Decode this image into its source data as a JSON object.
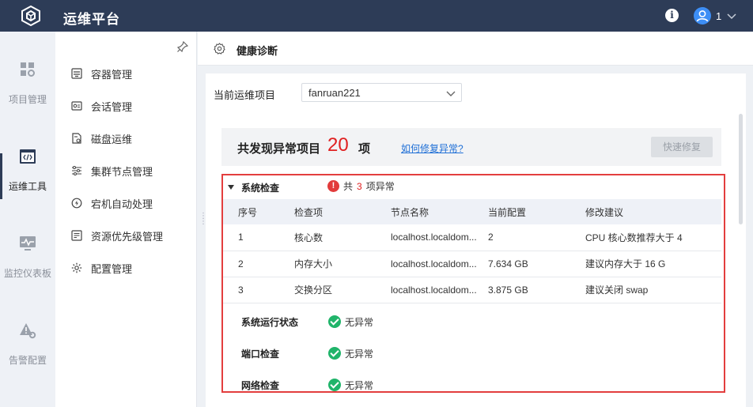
{
  "header": {
    "title": "运维平台",
    "user_name": "1"
  },
  "rail": [
    {
      "label": "项目管理",
      "icon": "grid-gear-icon"
    },
    {
      "label": "运维工具",
      "icon": "code-window-icon"
    },
    {
      "label": "监控仪表板",
      "icon": "monitor-pulse-icon"
    },
    {
      "label": "告警配置",
      "icon": "alert-gear-icon"
    }
  ],
  "submenu": [
    {
      "label": "容器管理",
      "icon": "container-icon"
    },
    {
      "label": "会话管理",
      "icon": "session-icon"
    },
    {
      "label": "磁盘运维",
      "icon": "disk-icon"
    },
    {
      "label": "集群节点管理",
      "icon": "sliders-icon"
    },
    {
      "label": "宕机自动处理",
      "icon": "auto-recover-icon"
    },
    {
      "label": "资源优先级管理",
      "icon": "priority-icon"
    },
    {
      "label": "配置管理",
      "icon": "config-gear-icon"
    }
  ],
  "breadcrumb": {
    "title": "健康诊断"
  },
  "project": {
    "label": "当前运维项目",
    "value": "fanruan221"
  },
  "summary": {
    "prefix": "共发现异常项目",
    "count": "20",
    "suffix": "项",
    "link": "如何修复异常?",
    "quick_fix": "快速修复"
  },
  "system_check": {
    "title": "系统检查",
    "status_prefix": "共",
    "status_count": "3",
    "status_suffix": "项异常",
    "columns": [
      "序号",
      "检查项",
      "节点名称",
      "当前配置",
      "修改建议"
    ],
    "rows": [
      [
        "1",
        "核心数",
        "localhost.localdom...",
        "2",
        "CPU 核心数推荐大于 4"
      ],
      [
        "2",
        "内存大小",
        "localhost.localdom...",
        "7.634 GB",
        "建议内存大于 16 G"
      ],
      [
        "3",
        "交换分区",
        "localhost.localdom...",
        "3.875 GB",
        "建议关闭 swap"
      ]
    ]
  },
  "other_checks": [
    {
      "title": "系统运行状态",
      "status": "无异常"
    },
    {
      "title": "端口检查",
      "status": "无异常"
    },
    {
      "title": "网络检查",
      "status": "无异常"
    }
  ]
}
